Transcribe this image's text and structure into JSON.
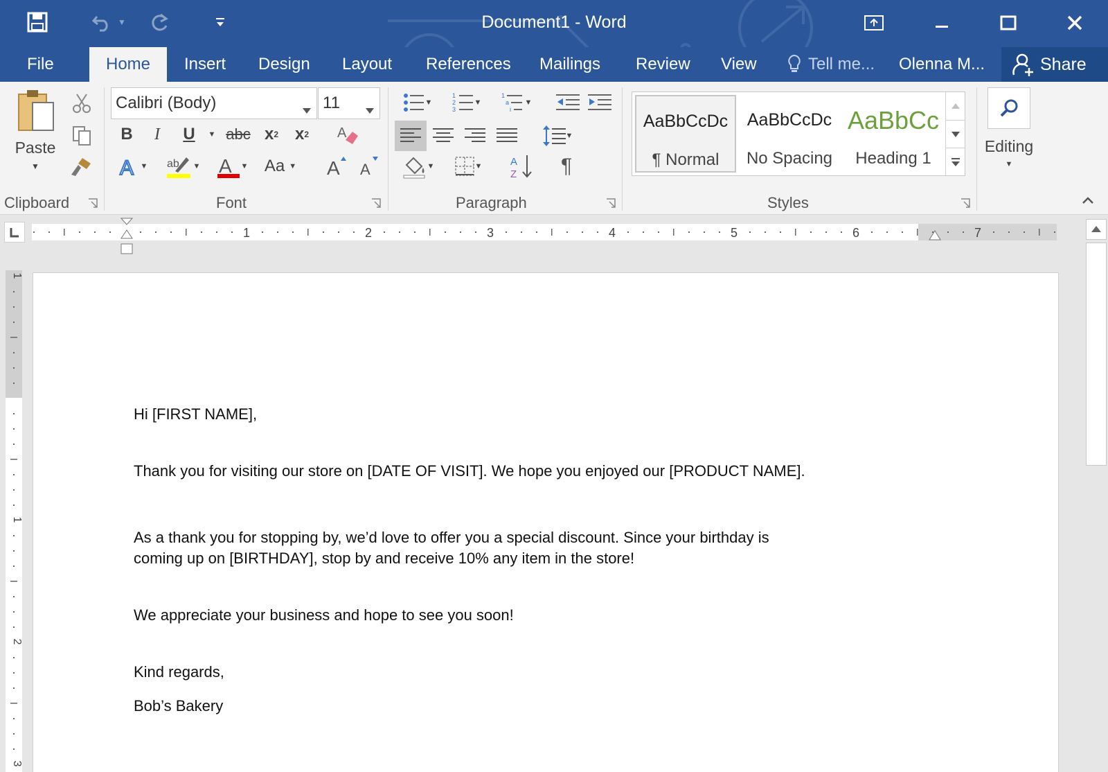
{
  "window": {
    "title": "Document1 - Word"
  },
  "tabs": [
    {
      "label": "File"
    },
    {
      "label": "Home"
    },
    {
      "label": "Insert"
    },
    {
      "label": "Design"
    },
    {
      "label": "Layout"
    },
    {
      "label": "References"
    },
    {
      "label": "Mailings"
    },
    {
      "label": "Review"
    },
    {
      "label": "View"
    }
  ],
  "tell_me": "Tell me...",
  "user": "Olenna M...",
  "share": "Share",
  "ribbon": {
    "clipboard": {
      "label": "Clipboard",
      "paste": "Paste"
    },
    "font": {
      "label": "Font",
      "font_name": "Calibri (Body)",
      "font_size": "11",
      "change_case": "Aa",
      "underline_color": "#ffff00",
      "font_color": "#e00000"
    },
    "paragraph": {
      "label": "Paragraph"
    },
    "styles": {
      "label": "Styles",
      "items": [
        {
          "sample": "AaBbCcDc",
          "name": "¶ Normal",
          "selected": true
        },
        {
          "sample": "AaBbCcDc",
          "name": "No Spacing"
        },
        {
          "sample": "AaBbCc",
          "name": "Heading 1",
          "color": "#6ba03c"
        }
      ]
    },
    "editing": {
      "label": "Editing"
    }
  },
  "ruler": {
    "numbers": [
      "1",
      "2",
      "3",
      "4",
      "5",
      "6",
      "7"
    ],
    "vnumbers": [
      "1",
      "1",
      "2",
      "3"
    ]
  },
  "document": {
    "lines": [
      "Hi [FIRST NAME],",
      "Thank you for visiting our store on [DATE OF VISIT]. We hope you enjoyed our [PRODUCT NAME].",
      "As a thank you for stopping by, we’d love to offer you a special discount. Since your birthday is",
      "coming up on [BIRTHDAY], stop by and receive 10% any item in the store!",
      "We appreciate your business and hope to see you soon!",
      "Kind regards,",
      "Bob’s Bakery"
    ]
  },
  "colors": {
    "brand": "#2b579a"
  }
}
